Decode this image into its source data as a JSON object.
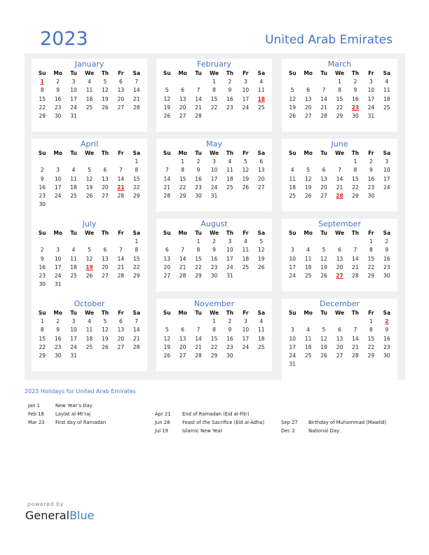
{
  "header": {
    "year": "2023",
    "country": "United Arab Emirates"
  },
  "weekdays": [
    "Su",
    "Mo",
    "Tu",
    "We",
    "Th",
    "Fr",
    "Sa"
  ],
  "months": [
    {
      "name": "January",
      "offset": 0,
      "days": 31,
      "holidays": [
        1
      ]
    },
    {
      "name": "February",
      "offset": 3,
      "days": 28,
      "holidays": [
        18
      ]
    },
    {
      "name": "March",
      "offset": 3,
      "days": 31,
      "holidays": [
        23
      ]
    },
    {
      "name": "April",
      "offset": 6,
      "days": 30,
      "holidays": [
        21
      ]
    },
    {
      "name": "May",
      "offset": 1,
      "days": 31,
      "holidays": []
    },
    {
      "name": "June",
      "offset": 4,
      "days": 30,
      "holidays": [
        28
      ]
    },
    {
      "name": "July",
      "offset": 6,
      "days": 31,
      "holidays": [
        19
      ]
    },
    {
      "name": "August",
      "offset": 2,
      "days": 31,
      "holidays": []
    },
    {
      "name": "September",
      "offset": 5,
      "days": 30,
      "holidays": [
        27
      ]
    },
    {
      "name": "October",
      "offset": 0,
      "days": 31,
      "holidays": []
    },
    {
      "name": "November",
      "offset": 3,
      "days": 30,
      "holidays": []
    },
    {
      "name": "December",
      "offset": 5,
      "days": 31,
      "holidays": [
        2
      ]
    }
  ],
  "holidays_title": "2023 Holidays for United Arab Emirates",
  "holiday_columns": [
    [
      {
        "date": "Jan 1",
        "name": "New Year’s Day"
      },
      {
        "date": "Feb 18",
        "name": "Laylat al-Mi’raj"
      },
      {
        "date": "Mar 23",
        "name": "First day of Ramadan"
      }
    ],
    [
      {
        "date": "Apr 21",
        "name": "End of Ramadan (Eid al-Fitr)"
      },
      {
        "date": "Jun 28",
        "name": "Feast of the Sacrifice (Eid al-Adha)"
      },
      {
        "date": "Jul 19",
        "name": "Islamic New Year"
      }
    ],
    [
      {
        "date": "Sep 27",
        "name": "Birthday of Muhammad (Mawlid)"
      },
      {
        "date": "Dec 2",
        "name": "National Day"
      }
    ]
  ],
  "footer": {
    "powered_by": "powered by",
    "brand_general": "General",
    "brand_blue": "Blue"
  },
  "colors": {
    "accent": "#4472c4",
    "holiday": "#e0201b",
    "panel": "#f0f0f0"
  }
}
